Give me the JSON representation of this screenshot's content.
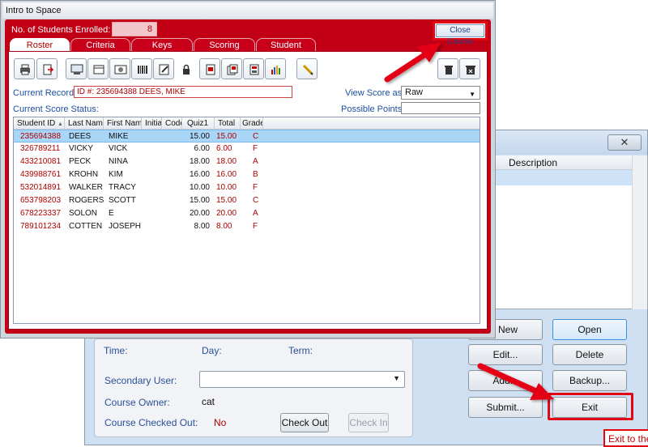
{
  "front_window": {
    "title": "Intro to Space",
    "enrolled_label": "No. of Students Enrolled:",
    "enrolled_count": "8",
    "close_course_label": "Close Course",
    "tabs": [
      {
        "label": "Roster",
        "active": true
      },
      {
        "label": "Criteria",
        "active": false
      },
      {
        "label": "Keys",
        "active": false
      },
      {
        "label": "Scoring",
        "active": false
      },
      {
        "label": "Student",
        "active": false
      }
    ],
    "toolbar_icons": [
      "print-icon",
      "export-icon",
      "class-icon",
      "box-icon",
      "photo-icon",
      "barcode-icon",
      "edit-icon",
      "lock-icon",
      "page-icon",
      "pages-icon",
      "calculator-icon",
      "chart-icon",
      "pencil-icon",
      "trash-icon",
      "delete-icon"
    ],
    "current_record_label": "Current Record:",
    "current_record_value": "ID #: 235694388 DEES, MIKE",
    "current_score_status_label": "Current Score Status:",
    "view_score_label": "View Score as:",
    "view_score_value": "Raw",
    "possible_points_label": "Possible Points:",
    "possible_points_value": "",
    "columns": [
      "Student ID",
      "Last Name",
      "First Name",
      "Initial",
      "Code",
      "Quiz1",
      "Total",
      "Grade"
    ],
    "rows": [
      {
        "id": "235694388",
        "last": "DEES",
        "first": "MIKE",
        "initial": "",
        "code": "",
        "quiz1": "15.00",
        "total": "15.00",
        "grade": "C"
      },
      {
        "id": "326789211",
        "last": "VICKY",
        "first": "VICK",
        "initial": "",
        "code": "",
        "quiz1": "6.00",
        "total": "6.00",
        "grade": "F"
      },
      {
        "id": "433210081",
        "last": "PECK",
        "first": "NINA",
        "initial": "",
        "code": "",
        "quiz1": "18.00",
        "total": "18.00",
        "grade": "A"
      },
      {
        "id": "439988761",
        "last": "KROHN",
        "first": "KIM",
        "initial": "",
        "code": "",
        "quiz1": "16.00",
        "total": "16.00",
        "grade": "B"
      },
      {
        "id": "532014891",
        "last": "WALKER",
        "first": "TRACY",
        "initial": "",
        "code": "",
        "quiz1": "10.00",
        "total": "10.00",
        "grade": "F"
      },
      {
        "id": "653798203",
        "last": "ROGERS",
        "first": "SCOTT",
        "initial": "",
        "code": "",
        "quiz1": "15.00",
        "total": "15.00",
        "grade": "C"
      },
      {
        "id": "678223337",
        "last": "SOLON",
        "first": "E",
        "initial": "",
        "code": "",
        "quiz1": "20.00",
        "total": "20.00",
        "grade": "A"
      },
      {
        "id": "789101234",
        "last": "COTTEN",
        "first": "JOSEPH",
        "initial": "",
        "code": "",
        "quiz1": "8.00",
        "total": "8.00",
        "grade": "F"
      }
    ],
    "selected_row": 0
  },
  "back_window": {
    "close_glyph": "✕",
    "description_header": "Description",
    "time_label": "Time:",
    "day_label": "Day:",
    "term_label": "Term:",
    "secondary_user_label": "Secondary User:",
    "course_owner_label": "Course Owner:",
    "course_owner_value": "cat",
    "checked_out_label": "Course Checked Out:",
    "checked_out_value": "No",
    "check_out_label": "Check Out",
    "check_in_label": "Check In",
    "buttons": {
      "new": "New",
      "open": "Open",
      "edit": "Edit...",
      "delete": "Delete",
      "add": "Add...",
      "backup": "Backup...",
      "submit": "Submit...",
      "exit": "Exit"
    },
    "tooltip": "Exit to the"
  },
  "colors": {
    "accent_red": "#c10016",
    "annotation_red": "#e30613",
    "selected_row": "#a9d5f7",
    "label_blue": "#2a4f9a"
  }
}
